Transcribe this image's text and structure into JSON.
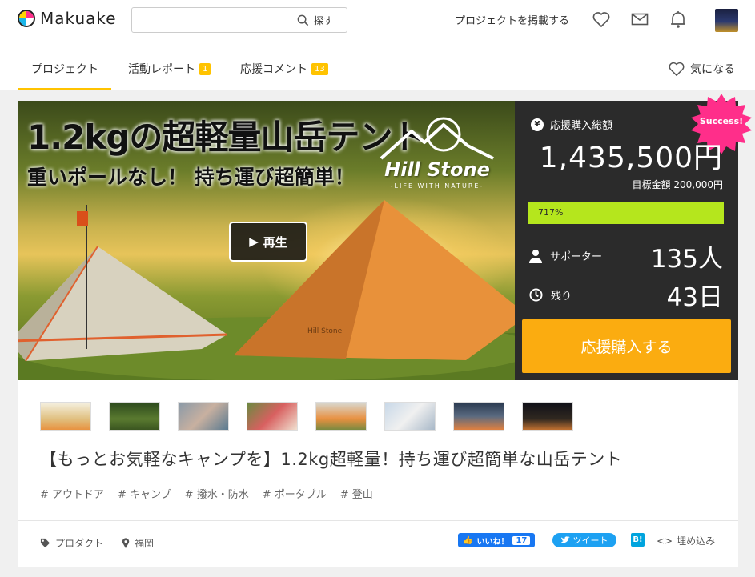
{
  "header": {
    "logo_text": "Makuake",
    "search": {
      "value": "",
      "placeholder": "",
      "button_label": "探す"
    },
    "post_project_label": "プロジェクトを掲載する",
    "icons": [
      "heart-icon",
      "mail-icon",
      "bell-icon",
      "avatar"
    ]
  },
  "tabs": [
    {
      "label": "プロジェクト",
      "badge": "",
      "active": true
    },
    {
      "label": "活動レポート",
      "badge": "1"
    },
    {
      "label": "応援コメント",
      "badge": "13"
    }
  ],
  "favorite_label": "気になる",
  "hero": {
    "title": "1.2kgの超軽量山岳テント",
    "subtitle": "重いポールなし！ 持ち運び超簡単！",
    "brand_name": "Hill Stone",
    "brand_tagline": "-LIFE WITH NATURE-",
    "tent_brand_text": "Hill Stone",
    "play_label": "再生"
  },
  "panel": {
    "success_label": "Success!",
    "total_label": "応援購入総額",
    "total_amount": "1,435,500円",
    "goal_text": "目標金額 200,000円",
    "progress_percent": 717,
    "progress_label": "717%",
    "supporters_label": "サポーター",
    "supporters_value": "135人",
    "remaining_label": "残り",
    "remaining_value": "43日",
    "cta_label": "応援購入する"
  },
  "colors": {
    "accent": "#ffc300",
    "cta": "#fbac10",
    "progress": "#b5e61d",
    "panel_bg": "#2b2b2b",
    "success": "#ff2e8a"
  },
  "thumbnails": [
    "thumb-1",
    "thumb-2",
    "thumb-3",
    "thumb-4",
    "thumb-5",
    "thumb-6",
    "thumb-7",
    "thumb-8"
  ],
  "project_title": "【もっとお気軽なキャンプを】1.2kg超軽量！持ち運び超簡単な山岳テント",
  "tags": [
    "# アウトドア",
    "# キャンプ",
    "# 撥水・防水",
    "# ポータブル",
    "# 登山"
  ],
  "meta": {
    "category": "プロダクト",
    "location": "福岡"
  },
  "share": {
    "facebook_label": "いいね！",
    "facebook_count": "17",
    "twitter_label": "ツイート",
    "hatena_label": "B!",
    "embed_label": "埋め込み"
  }
}
